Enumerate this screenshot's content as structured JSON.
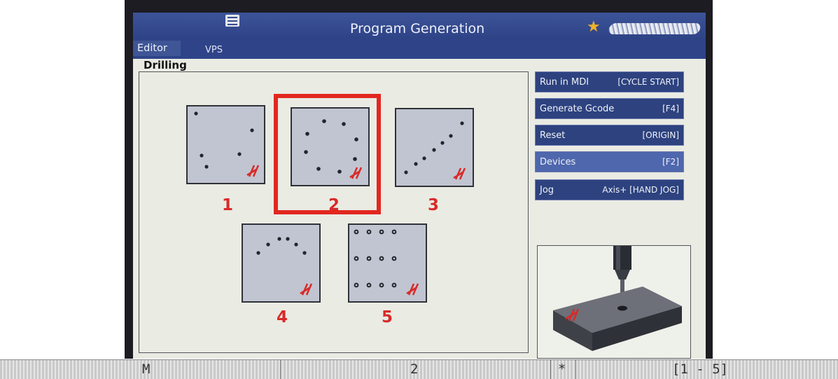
{
  "window": {
    "title": "Program Generation",
    "tabs": [
      {
        "label": "Editor",
        "active": true
      },
      {
        "label": "VPS",
        "active": false
      }
    ],
    "menu_icon": "hamburger-menu-icon",
    "favorite_icon": "star-icon"
  },
  "group": {
    "label": "Drilling"
  },
  "patterns": [
    {
      "number": "1",
      "description": "random holes"
    },
    {
      "number": "2",
      "description": "bolt circle",
      "selected": true
    },
    {
      "number": "3",
      "description": "line of holes"
    },
    {
      "number": "4",
      "description": "arc of holes"
    },
    {
      "number": "5",
      "description": "grid of holes"
    }
  ],
  "side_buttons": [
    {
      "label": "Run in MDI",
      "key": "[CYCLE START]"
    },
    {
      "label": "Generate Gcode",
      "key": "[F4]"
    },
    {
      "label": "Reset",
      "key": "[ORIGIN]"
    },
    {
      "label": "Devices",
      "key": "[F2]"
    },
    {
      "label": "Jog",
      "key": "Axis+ [HAND JOG]"
    }
  ],
  "status_bar": {
    "mode": "M",
    "value": "2",
    "flag": "*",
    "range": "[1 - 5]"
  },
  "colors": {
    "accent_red": "#d82a28",
    "titlebar_blue": "#2e4386",
    "button_blue": "#2d427f"
  }
}
